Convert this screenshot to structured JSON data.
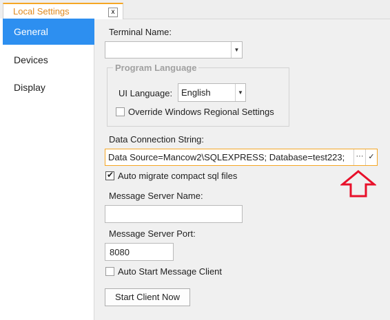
{
  "tab": {
    "title": "Local Settings",
    "close_label": "x"
  },
  "sidebar": {
    "items": [
      {
        "label": "General",
        "active": true
      },
      {
        "label": "Devices",
        "active": false
      },
      {
        "label": "Display",
        "active": false
      }
    ]
  },
  "form": {
    "terminal_name": {
      "label": "Terminal Name:",
      "value": ""
    },
    "program_language": {
      "group_title": "Program Language",
      "ui_language_label": "UI Language:",
      "ui_language_value": "English",
      "override_label": "Override Windows Regional Settings",
      "override_checked": false
    },
    "connection": {
      "label": "Data Connection String:",
      "value": "Data Source=Mancow2\\SQLEXPRESS; Database=test223;",
      "more_label": "···",
      "confirm_label": "✓"
    },
    "auto_migrate": {
      "label": "Auto migrate compact sql files",
      "checked": true
    },
    "message_server_name": {
      "label": "Message Server Name:",
      "value": ""
    },
    "message_server_port": {
      "label": "Message Server Port:",
      "value": "8080"
    },
    "auto_start": {
      "label": "Auto Start Message Client",
      "checked": false
    },
    "start_button": {
      "label": "Start Client Now"
    }
  },
  "annotation": {
    "color": "#e8102a",
    "icon": "up-arrow-outline"
  }
}
